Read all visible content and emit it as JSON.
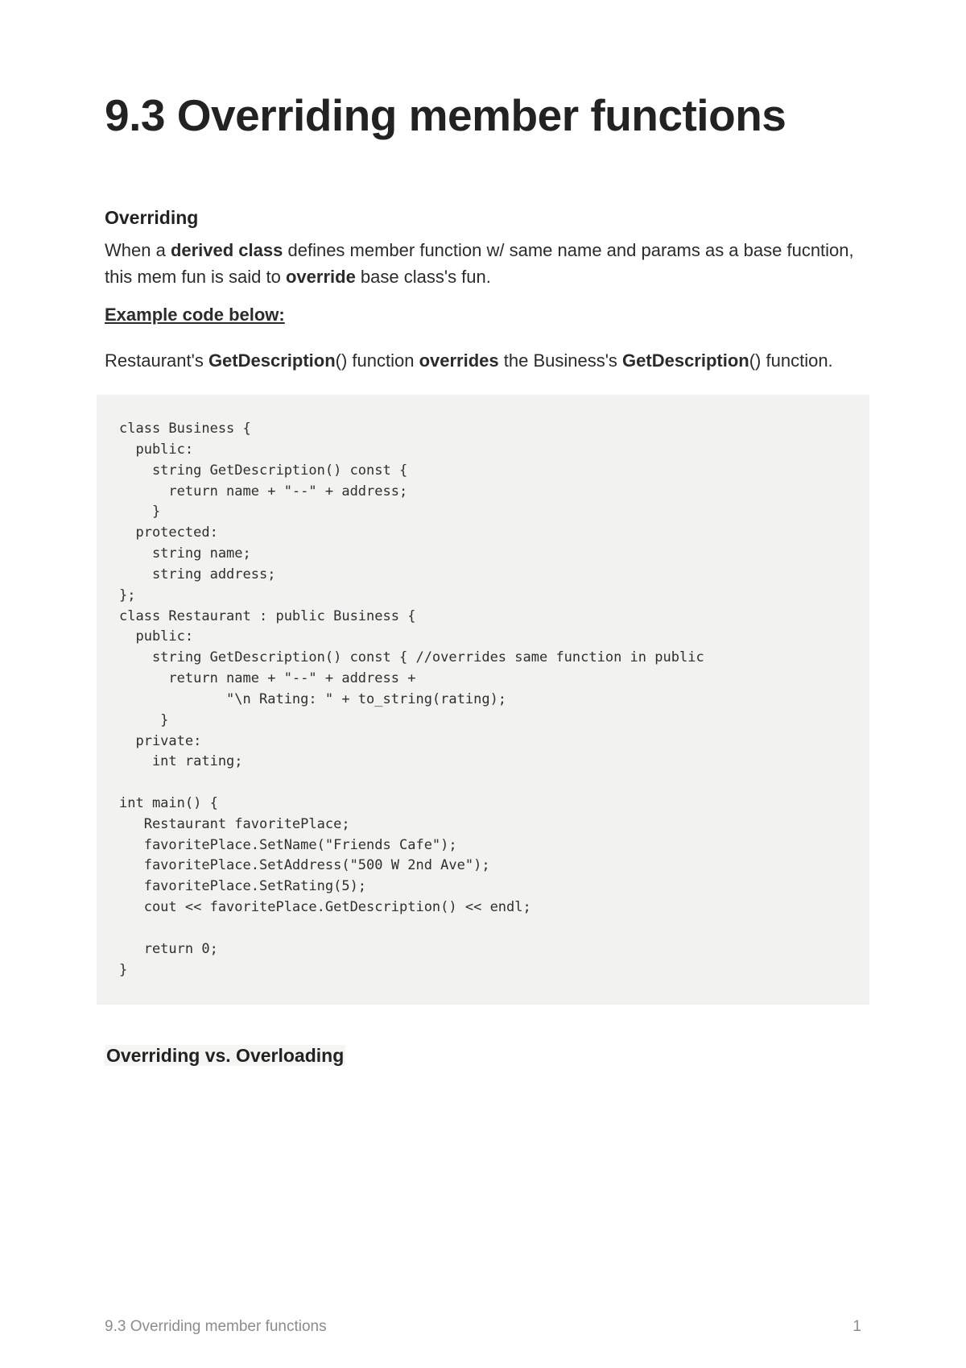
{
  "title": "9.3 Overriding member functions",
  "section1": {
    "heading": "Overriding",
    "para1_pre": "When a ",
    "para1_b1": "derived class",
    "para1_mid": " defines member function w/ same name and params as a base fucntion, this mem fun is said to ",
    "para1_b2": "override",
    "para1_post": " base class's fun.",
    "example_label": "Example code below:",
    "para2_pre": "Restaurant's ",
    "para2_b1": "GetDescription",
    "para2_mid1": "() function ",
    "para2_b2": "overrides",
    "para2_mid2": " the Business's ",
    "para2_b3": "GetDescription",
    "para2_post": "() function."
  },
  "code": "class Business {\n  public:\n    string GetDescription() const {\n      return name + \"--\" + address;\n    }\n  protected:\n    string name;\n    string address;\n};\nclass Restaurant : public Business {\n  public:\n    string GetDescription() const { //overrides same function in public\n      return name + \"--\" + address +\n             \"\\n Rating: \" + to_string(rating);\n     }\n  private:\n    int rating;\n\nint main() {\n   Restaurant favoritePlace;\n   favoritePlace.SetName(\"Friends Cafe\");\n   favoritePlace.SetAddress(\"500 W 2nd Ave\");\n   favoritePlace.SetRating(5);\n   cout << favoritePlace.GetDescription() << endl;\n\n   return 0;\n}",
  "section2": {
    "heading": "Overriding vs. Overloading"
  },
  "footer": {
    "title": "9.3 Overriding member functions",
    "page": "1"
  }
}
